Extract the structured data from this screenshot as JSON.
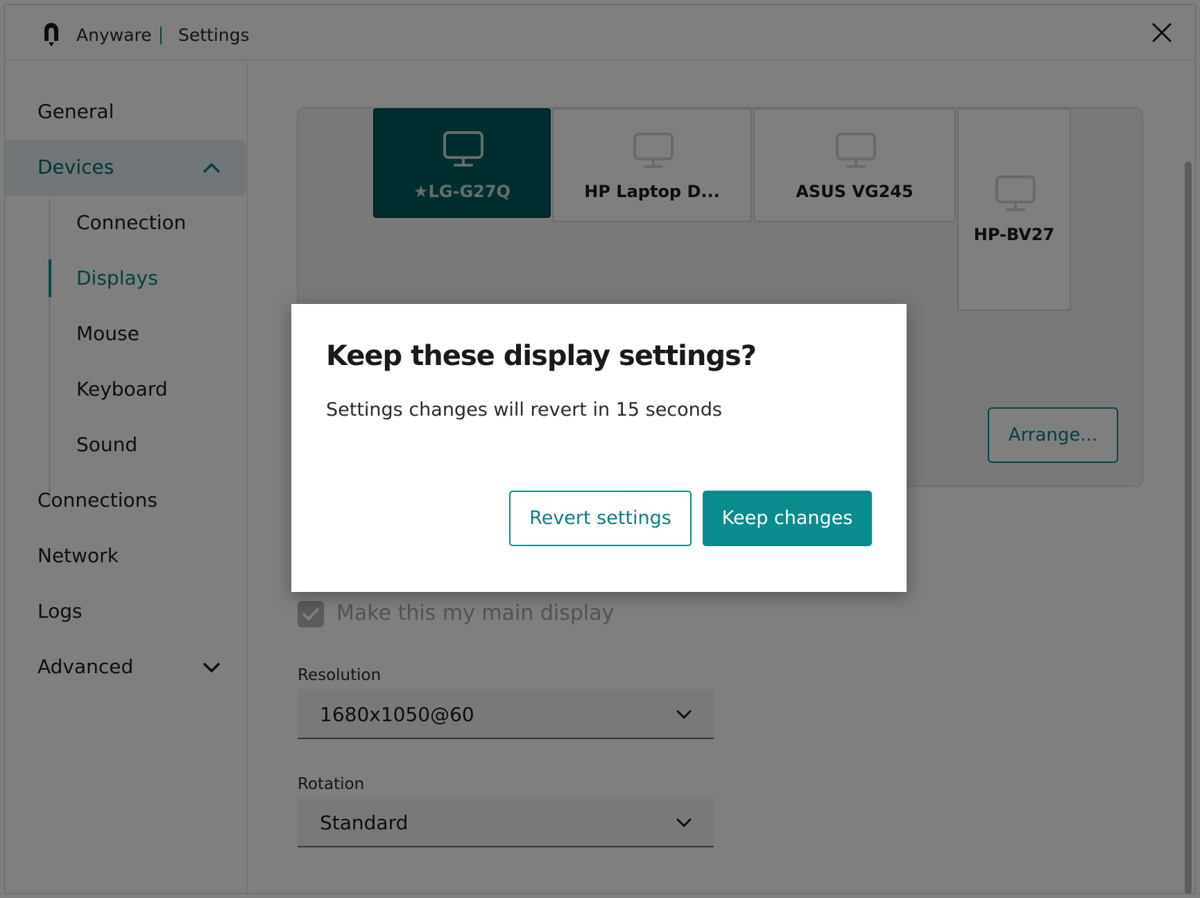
{
  "titlebar": {
    "app_name": "Anyware",
    "page_title": "Settings",
    "close_icon": "close-icon",
    "logo_icon": "anyware-logo-icon"
  },
  "sidebar": {
    "items": [
      {
        "label": "General"
      },
      {
        "label": "Devices",
        "expanded": true,
        "icon": "chevron-up-icon"
      },
      {
        "label": "Connections"
      },
      {
        "label": "Network"
      },
      {
        "label": "Logs"
      },
      {
        "label": "Advanced",
        "icon": "chevron-down-icon"
      }
    ],
    "sub_items": [
      {
        "label": "Connection"
      },
      {
        "label": "Displays",
        "active": true
      },
      {
        "label": "Mouse"
      },
      {
        "label": "Keyboard"
      },
      {
        "label": "Sound"
      }
    ]
  },
  "displays": {
    "monitors": [
      {
        "label": "★LG-G27Q",
        "selected": true
      },
      {
        "label": "HP Laptop D..."
      },
      {
        "label": "ASUS VG245"
      },
      {
        "label": "HP-BV27"
      }
    ],
    "arrange_label": "Arrange...",
    "main_display_label": "Make this my main display",
    "main_display_checked": true,
    "resolution_label": "Resolution",
    "resolution_value": "1680x1050@60",
    "rotation_label": "Rotation",
    "rotation_value": "Standard"
  },
  "dialog": {
    "title": "Keep these display settings?",
    "message": "Settings changes will revert in 15 seconds",
    "revert_label": "Revert settings",
    "keep_label": "Keep changes"
  },
  "colors": {
    "accent": "#0a8c8f",
    "selected_monitor": "#005c61",
    "sidebar_expanded_bg": "#e3eef0"
  }
}
